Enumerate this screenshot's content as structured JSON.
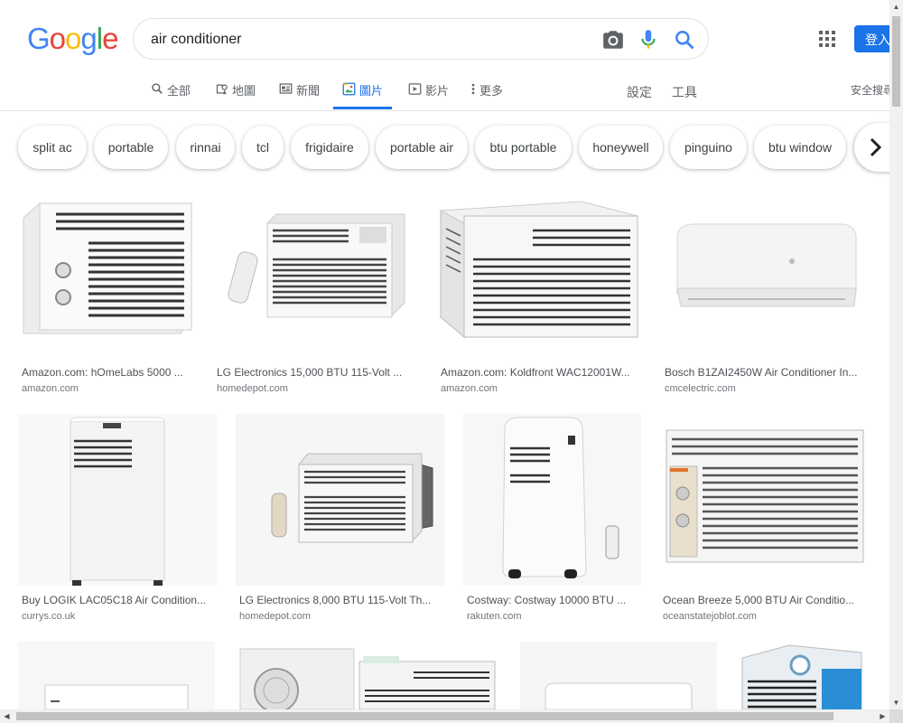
{
  "header": {
    "query": "air conditioner",
    "signin_label": "登入",
    "safesearch_label": "安全搜尋"
  },
  "tabs": [
    {
      "label": "全部",
      "icon": "search-icon"
    },
    {
      "label": "地圖",
      "icon": "map-icon"
    },
    {
      "label": "新聞",
      "icon": "news-icon"
    },
    {
      "label": "圖片",
      "icon": "image-icon",
      "active": true
    },
    {
      "label": "影片",
      "icon": "video-icon"
    },
    {
      "label": "更多",
      "icon": "more-vert-icon"
    }
  ],
  "tools": {
    "settings": "設定",
    "tools": "工具"
  },
  "chips": [
    "split ac",
    "portable",
    "rinnai",
    "tcl",
    "frigidaire",
    "portable air",
    "btu portable",
    "honeywell",
    "pinguino",
    "btu window"
  ],
  "results": [
    {
      "title": "Amazon.com: hOmeLabs 5000 ...",
      "source": "amazon.com"
    },
    {
      "title": "LG Electronics 15,000 BTU 115-Volt ...",
      "source": "homedepot.com"
    },
    {
      "title": "Amazon.com: Koldfront WAC12001W...",
      "source": "amazon.com"
    },
    {
      "title": "Bosch B1ZAI2450W Air Conditioner In...",
      "source": "cmcelectric.com"
    },
    {
      "title": "Buy LOGIK LAC05C18 Air Condition...",
      "source": "currys.co.uk"
    },
    {
      "title": "LG Electronics 8,000 BTU 115-Volt Th...",
      "source": "homedepot.com"
    },
    {
      "title": "Costway: Costway 10000 BTU ...",
      "source": "rakuten.com"
    },
    {
      "title": "Ocean Breeze 5,000 BTU Air Conditio...",
      "source": "oceanstatejoblot.com"
    }
  ],
  "colors": {
    "accent": "#1a73e8",
    "chip_text": "#3c4043",
    "title_text": "#4d5156",
    "source_text": "#70757a"
  }
}
